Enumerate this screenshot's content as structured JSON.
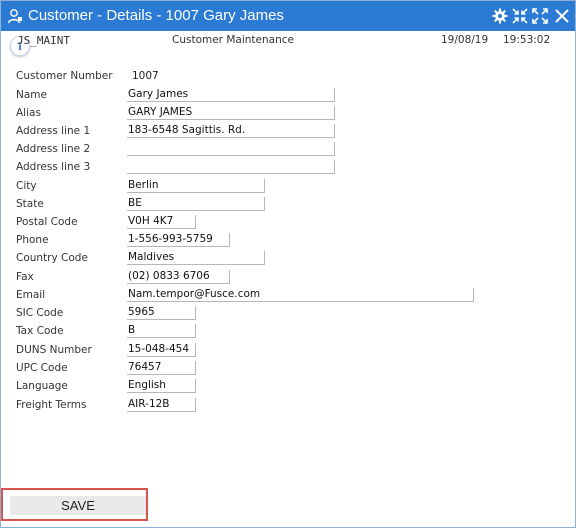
{
  "window": {
    "title": "Customer - Details - 1007 Gary James",
    "icons": [
      "person-icon",
      "gear-icon",
      "shrink-icon",
      "expand-icon",
      "close-icon"
    ]
  },
  "header": {
    "info_glyph": "i",
    "program": "JS_MAINT",
    "caption": "Customer Maintenance",
    "date": "19/08/19",
    "time": "19:53:02"
  },
  "form": {
    "customer_number_label": "Customer Number",
    "customer_number": "1007",
    "fields": [
      {
        "label": "Name",
        "value": "Gary James"
      },
      {
        "label": "Alias",
        "value": "GARY JAMES"
      },
      {
        "label": "Address line 1",
        "value": "183-6548 Sagittis. Rd."
      },
      {
        "label": "Address line 2",
        "value": ""
      },
      {
        "label": "Address line 3",
        "value": ""
      },
      {
        "label": "City",
        "value": "Berlin"
      },
      {
        "label": "State",
        "value": "BE"
      },
      {
        "label": "Postal Code",
        "value": "V0H 4K7"
      },
      {
        "label": "Phone",
        "value": "1-556-993-5759"
      },
      {
        "label": "Country Code",
        "value": "Maldives"
      },
      {
        "label": "Fax",
        "value": "(02) 0833 6706"
      },
      {
        "label": "Email",
        "value": "Nam.tempor@Fusce.com"
      },
      {
        "label": "SIC Code",
        "value": "5965"
      },
      {
        "label": "Tax Code",
        "value": "B"
      },
      {
        "label": "DUNS Number",
        "value": "15-048-454"
      },
      {
        "label": "UPC Code",
        "value": "76457"
      },
      {
        "label": "Language",
        "value": "English"
      },
      {
        "label": "Freight Terms",
        "value": "AIR-12B"
      }
    ]
  },
  "actions": {
    "save_label": "SAVE"
  },
  "colors": {
    "titlebar": "#2b7ad3",
    "highlight_border": "#d9534f"
  }
}
